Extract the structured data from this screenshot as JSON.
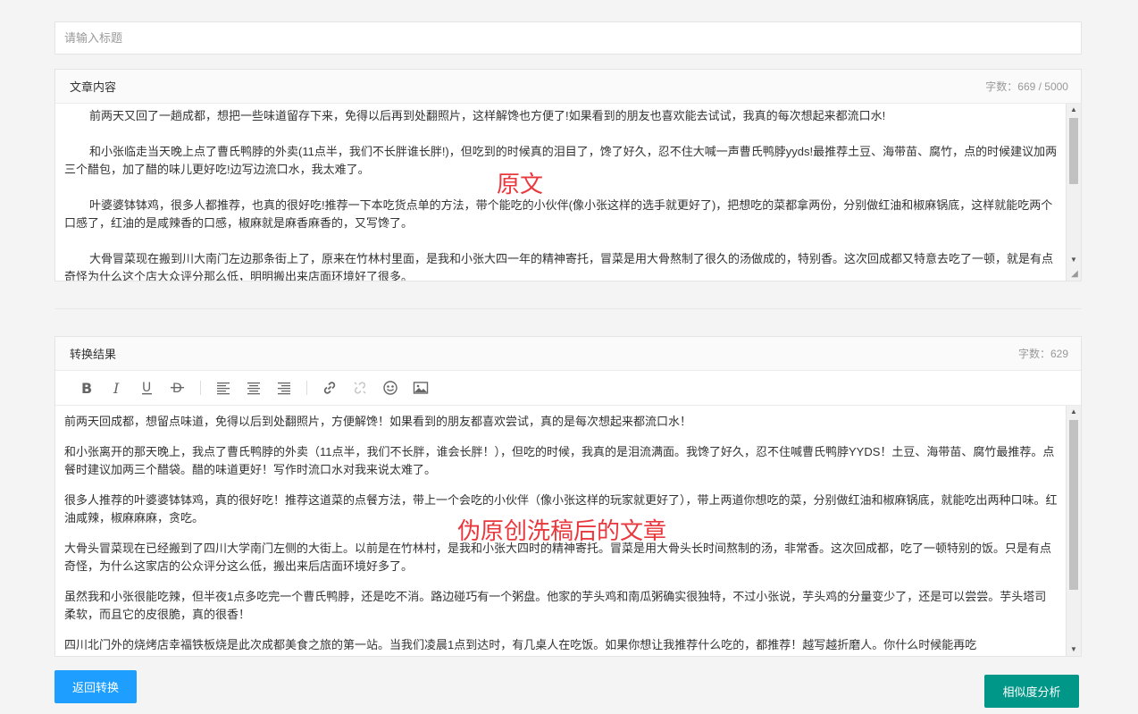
{
  "title_input": {
    "placeholder": "请输入标题",
    "value": ""
  },
  "original": {
    "header": "文章内容",
    "word_count": "字数：669 / 5000",
    "paragraphs": [
      "前两天又回了一趟成都，想把一些味道留存下来，免得以后再到处翻照片，这样解馋也方便了!如果看到的朋友也喜欢能去试试，我真的每次想起来都流口水!",
      "和小张临走当天晚上点了曹氏鸭脖的外卖(11点半，我们不长胖谁长胖!)，但吃到的时候真的泪目了，馋了好久，忍不住大喊一声曹氏鸭脖yyds!最推荐土豆、海带苗、腐竹，点的时候建议加两三个醋包，加了醋的味儿更好吃!边写边流口水，我太难了。",
      "叶婆婆钵钵鸡，很多人都推荐，也真的很好吃!推荐一下本吃货点单的方法，带个能吃的小伙伴(像小张这样的选手就更好了)，把想吃的菜都拿两份，分别做红油和椒麻锅底，这样就能吃两个口感了，红油的是咸辣香的口感，椒麻就是麻香麻香的，又写馋了。",
      "大骨冒菜现在搬到川大南门左边那条街上了，原来在竹林村里面，是我和小张大四一年的精神寄托，冒菜是用大骨熬制了很久的汤做成的，特别香。这次回成都又特意去吃了一顿，就是有点奇怪为什么这个店大众评分那么低，明明搬出来店面环境好了很多。"
    ],
    "annotation": "原文"
  },
  "result": {
    "header": "转换结果",
    "word_count": "字数：629",
    "toolbar": [
      "bold-icon",
      "italic-icon",
      "underline-icon",
      "strikethrough-icon",
      "align-left-icon",
      "align-center-icon",
      "align-right-icon",
      "link-icon",
      "unlink-icon",
      "emoji-icon",
      "image-icon"
    ],
    "paragraphs": [
      "前两天回成都，想留点味道，免得以后到处翻照片，方便解馋！如果看到的朋友都喜欢尝试，真的是每次想起来都流口水！",
      "和小张离开的那天晚上，我点了曹氏鸭脖的外卖（11点半，我们不长胖，谁会长胖！），但吃的时候，我真的是泪流满面。我馋了好久，忍不住喊曹氏鸭脖YYDS！土豆、海带苗、腐竹最推荐。点餐时建议加两三个醋袋。醋的味道更好！写作时流口水对我来说太难了。",
      "很多人推荐的叶婆婆钵钵鸡，真的很好吃！推荐这道菜的点餐方法，带上一个会吃的小伙伴（像小张这样的玩家就更好了），带上两道你想吃的菜，分别做红油和椒麻锅底，就能吃出两种口味。红油咸辣，椒麻麻麻，贪吃。",
      "大骨头冒菜现在已经搬到了四川大学南门左侧的大街上。以前是在竹林村，是我和小张大四时的精神寄托。冒菜是用大骨头长时间熬制的汤，非常香。这次回成都，吃了一顿特别的饭。只是有点奇怪，为什么这家店的公众评分这么低，搬出来后店面环境好多了。",
      "虽然我和小张很能吃辣，但半夜1点多吃完一个曹氏鸭脖，还是吃不消。路边碰巧有一个粥盘。他家的芋头鸡和南瓜粥确实很独特，不过小张说，芋头鸡的分量变少了，还是可以尝尝。芋头塔司柔软，而且它的皮很脆，真的很香！",
      "四川北门外的烧烤店幸福铁板烧是此次成都美食之旅的第一站。当我们凌晨1点到达时，有几桌人在吃饭。如果你想让我推荐什么吃的，都推荐！越写越折磨人。你什么时候能再吃"
    ],
    "annotation": "伪原创洗稿后的文章"
  },
  "buttons": {
    "back": "返回转换",
    "similarity": "相似度分析"
  },
  "colors": {
    "primary_blue": "#1e9fff",
    "teal": "#009688",
    "annotation_red": "#e8383d"
  }
}
